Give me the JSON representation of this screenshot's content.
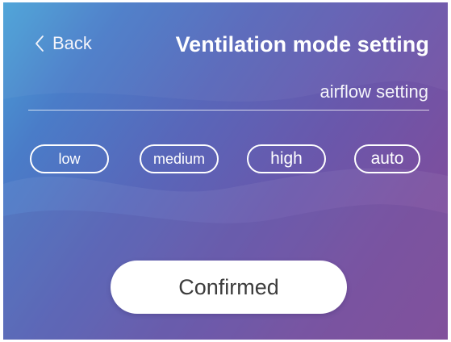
{
  "header": {
    "back_label": "Back",
    "title": "Ventilation mode setting"
  },
  "section": {
    "label": "airflow setting"
  },
  "airflow_options": [
    {
      "label": "low"
    },
    {
      "label": "medium"
    },
    {
      "label": "high"
    },
    {
      "label": "auto"
    }
  ],
  "confirm": {
    "label": "Confirmed"
  },
  "colors": {
    "background_start": "#4aa3d8",
    "background_end": "#824c9b",
    "text": "#ffffff",
    "button_bg": "#ffffff",
    "button_text": "#3c3c3c"
  }
}
